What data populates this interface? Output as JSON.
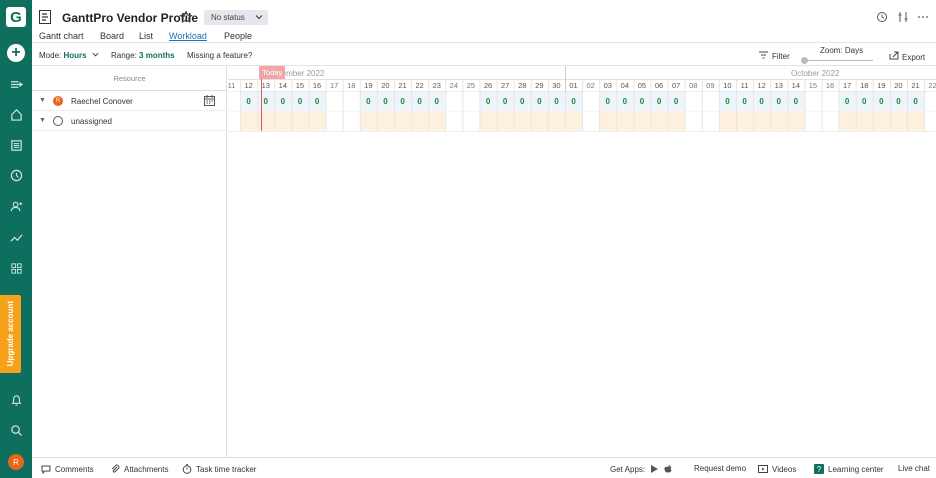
{
  "app": {
    "logo_letter": "G"
  },
  "sidebar": {
    "add_label": "+",
    "upgrade_label": "Upgrade account",
    "user_initial": "R",
    "icons": [
      "collapse-icon",
      "home-icon",
      "projects-list-icon",
      "time-icon",
      "people-icon",
      "portfolio-icon",
      "apps-grid-icon",
      "bell-icon",
      "search-icon"
    ]
  },
  "header": {
    "project_title": "GanttPro Vendor Profile",
    "status": "No status",
    "tabs": [
      {
        "label": "Gantt chart",
        "active": false
      },
      {
        "label": "Board",
        "active": false
      },
      {
        "label": "List",
        "active": false
      },
      {
        "label": "Workload",
        "active": true
      },
      {
        "label": "People",
        "active": false
      }
    ]
  },
  "toolbar": {
    "mode_label": "Mode:",
    "mode_value": "Hours",
    "range_label": "Range:",
    "range_value": "3 months",
    "missing_feature": "Missing a feature?",
    "filter_label": "Filter",
    "zoom_label": "Zoom: Days",
    "export_label": "Export"
  },
  "resources": {
    "header": "Resource",
    "rows": [
      {
        "name": "Raechel Conover",
        "initial": "R",
        "type": "user"
      },
      {
        "name": "unassigned",
        "initial": "",
        "type": "unassigned"
      }
    ]
  },
  "timeline": {
    "month_sept": "ptember 2022",
    "month_oct": "October 2022",
    "today_label": "Today",
    "days": [
      "11",
      "12",
      "13",
      "14",
      "15",
      "16",
      "17",
      "18",
      "19",
      "20",
      "21",
      "22",
      "23",
      "24",
      "25",
      "26",
      "27",
      "28",
      "29",
      "30",
      "01",
      "02",
      "03",
      "04",
      "05",
      "06",
      "07",
      "08",
      "09",
      "10",
      "11",
      "12",
      "13",
      "14",
      "15",
      "16",
      "17",
      "18",
      "19",
      "20",
      "21",
      "22",
      "23"
    ],
    "weekend": [
      true,
      false,
      false,
      false,
      false,
      false,
      true,
      true,
      false,
      false,
      false,
      false,
      false,
      true,
      true,
      false,
      false,
      false,
      false,
      false,
      false,
      true,
      false,
      false,
      false,
      false,
      false,
      true,
      true,
      false,
      false,
      false,
      false,
      false,
      true,
      true,
      false,
      false,
      false,
      false,
      false,
      true,
      true
    ],
    "workload_value": "0"
  },
  "footer": {
    "comments": "Comments",
    "attachments": "Attachments",
    "time_tracker": "Task time tracker",
    "get_apps": "Get Apps:",
    "request_demo": "Request demo",
    "videos": "Videos",
    "learning_center": "Learning center",
    "live_chat": "Live chat"
  }
}
